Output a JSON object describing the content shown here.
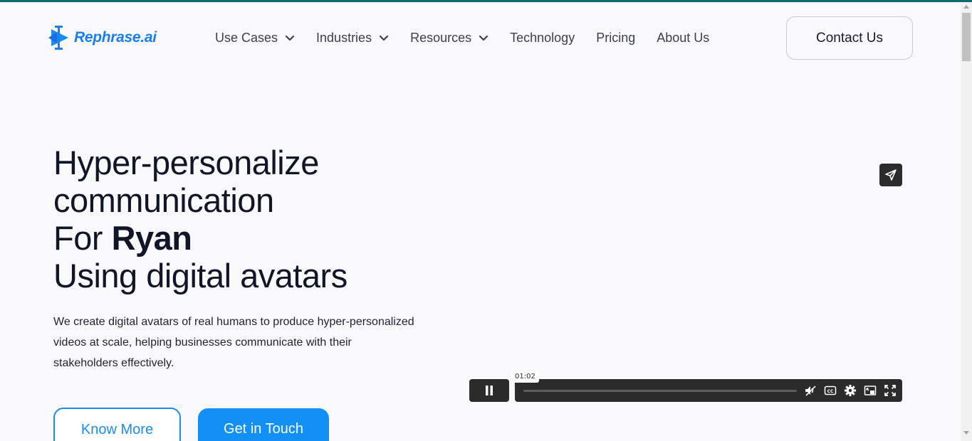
{
  "brand": {
    "name": "Rephrase.ai",
    "color": "#1a7ff0"
  },
  "nav": {
    "items": [
      {
        "label": "Use Cases",
        "dropdown": true
      },
      {
        "label": "Industries",
        "dropdown": true
      },
      {
        "label": "Resources",
        "dropdown": true
      },
      {
        "label": "Technology",
        "dropdown": false
      },
      {
        "label": "Pricing",
        "dropdown": false
      },
      {
        "label": "About Us",
        "dropdown": false
      }
    ],
    "contact_label": "Contact Us"
  },
  "hero": {
    "line1": "Hyper-personalize",
    "line2": "communication",
    "line3_prefix": "For ",
    "line3_name": "Ryan",
    "line4": "Using digital avatars",
    "description": "We create digital avatars of real humans to produce hyper-personalized videos at scale, helping businesses communicate with their stakeholders effectively.",
    "primary_cta": "Get in Touch",
    "secondary_cta": "Know More"
  },
  "video": {
    "time_label": "01:02",
    "progress": 0.0,
    "controls": [
      "share-icon",
      "pause-icon",
      "mute-icon",
      "captions-icon",
      "settings-icon",
      "picture-in-picture-icon",
      "fullscreen-icon"
    ]
  },
  "colors": {
    "accent": "#1290f5",
    "text": "#111528",
    "player": "#2b2b2b",
    "top_strip": "#116b6b"
  }
}
